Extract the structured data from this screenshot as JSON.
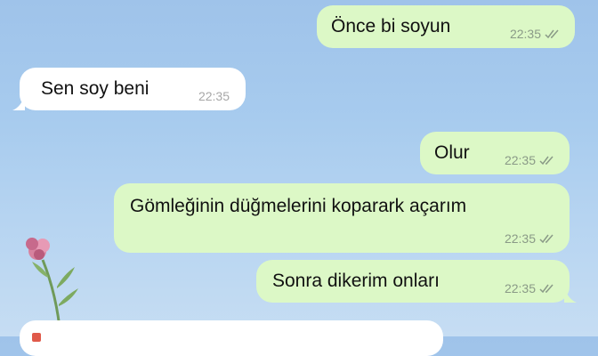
{
  "messages": [
    {
      "direction": "out",
      "text": "Önce bi soyun",
      "time": "22:35",
      "status": "read"
    },
    {
      "direction": "in",
      "text": "Sen soy beni",
      "time": "22:35"
    },
    {
      "direction": "out",
      "text": "Olur",
      "time": "22:35",
      "status": "read"
    },
    {
      "direction": "out",
      "text": "Gömleğinin düğmelerini koparark açarım",
      "time": "22:35",
      "status": "read"
    },
    {
      "direction": "out",
      "text": "Sonra dikerim onları",
      "time": "22:35",
      "status": "read"
    }
  ],
  "colors": {
    "outgoing_bubble": "#dcf8c6",
    "incoming_bubble": "#ffffff",
    "read_ticks": "#8a9a87",
    "wallpaper": "#a7cbee"
  },
  "icons": {
    "read_receipt": "double-check-icon",
    "wallpaper_decoration": "flower-icon"
  }
}
